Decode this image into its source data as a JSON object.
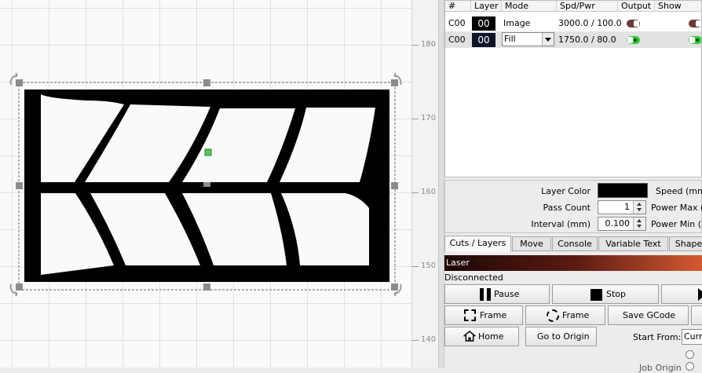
{
  "ruler": {
    "ticks": [
      "180",
      "170",
      "160",
      "150",
      "140"
    ]
  },
  "layers_table": {
    "headers": [
      "#",
      "Layer",
      "Mode",
      "Spd/Pwr",
      "Output",
      "Show"
    ],
    "rows": [
      {
        "num": "C00",
        "layer": "00",
        "mode": "Image",
        "spd_pwr": "3000.0 / 100.0",
        "output": false,
        "show": false
      },
      {
        "num": "C00",
        "layer": "00",
        "mode": "Fill",
        "spd_pwr": "1750.0 / 80.0",
        "output": true,
        "show": true
      }
    ]
  },
  "layer_settings": {
    "layer_color_label": "Layer Color",
    "pass_count_label": "Pass Count",
    "pass_count_value": "1",
    "interval_label": "Interval (mm)",
    "interval_value": "0.100",
    "speed_label": "Speed (mm/",
    "power_max_label": "Power Max (",
    "power_min_label": "Power Min (",
    "layer_color": "#000000"
  },
  "tabs": [
    "Cuts / Layers",
    "Move",
    "Console",
    "Variable Text",
    "Shape"
  ],
  "laser": {
    "title": "Laser",
    "status": "Disconnected",
    "pause": "Pause",
    "stop": "Stop",
    "frame1": "Frame",
    "frame2": "Frame",
    "save_gcode": "Save GCode",
    "home": "Home",
    "go_to_origin": "Go to Origin",
    "start_from_label": "Start From:",
    "start_from_value": "Curr",
    "job_origin_label": "Job Origin"
  },
  "colors": {
    "output_on": "#34c440",
    "output_off": "#6b3a35",
    "handle": "#8c8c8c",
    "center_marker": "#5bc45b"
  }
}
